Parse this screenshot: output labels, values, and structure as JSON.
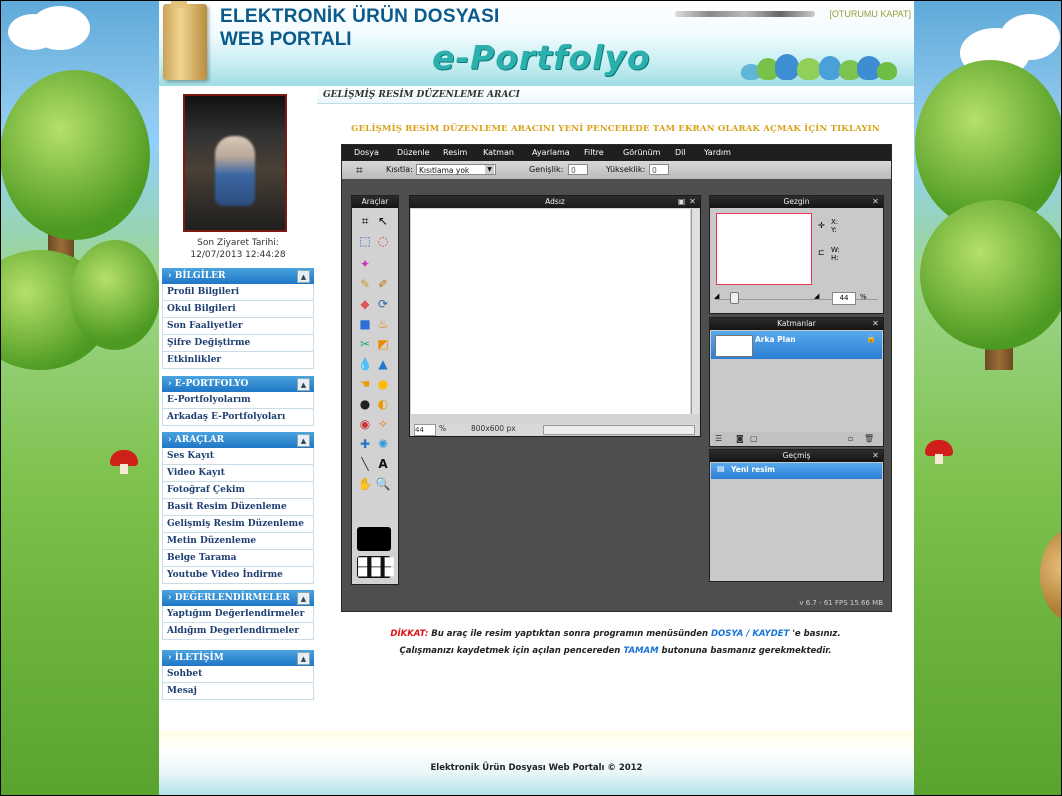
{
  "header": {
    "title_line1": "ELEKTRONİK ÜRÜN DOSYASI",
    "title_line2": "WEB PORTALI",
    "brand": "e-Portfolyo",
    "logout": "[OTURUMU KAPAT]"
  },
  "sidebar": {
    "last_visit_label": "Son Ziyaret Tarihi:",
    "last_visit_value": "12/07/2013 12:44:28",
    "sections": [
      {
        "title": "› BİLGİLER",
        "items": [
          "Profil Bilgileri",
          "Okul Bilgileri",
          "Son Faaliyetler",
          "Şifre Değiştirme",
          "Etkinlikler"
        ]
      },
      {
        "title": "› E-PORTFOLYO",
        "items": [
          "E-Portfolyolarım",
          "Arkadaş E-Portfolyoları"
        ]
      },
      {
        "title": "› ARAÇLAR",
        "items": [
          "Ses Kayıt",
          "Video Kayıt",
          "Fotoğraf Çekim",
          "Basit Resim Düzenleme",
          "Gelişmiş Resim Düzenleme",
          "Metin Düzenleme",
          "Belge Tarama",
          "Youtube Video İndirme"
        ]
      },
      {
        "title": "› DEĞERLENDİRMELER",
        "items": [
          "Yaptığım Değerlendirmeler",
          "Aldığım Degerlendirmeler"
        ]
      },
      {
        "title": "› İLETİŞİM",
        "items": [
          "Sohbet",
          "Mesaj"
        ]
      }
    ]
  },
  "content": {
    "page_title": "GELİŞMİŞ RESİM DÜZENLEME ARACI",
    "open_fullscreen_link": "GELİŞMİŞ RESİM DÜZENLEME ARACINI YENİ PENCEREDE TAM EKRAN OLARAK AÇMAK İÇİN TIKLAYIN"
  },
  "editor": {
    "menu": [
      "Dosya",
      "Düzenle",
      "Resim",
      "Katman",
      "Ayarlama",
      "Filtre",
      "Görünüm",
      "Dil",
      "Yardım"
    ],
    "toolbar": {
      "constraint_label": "Kısıtla:",
      "constraint_value": "Kısıtlama yok",
      "width_label": "Genişlik:",
      "width_value": "0",
      "height_label": "Yükseklik:",
      "height_value": "0"
    },
    "tools_panel_title": "Araçlar",
    "canvas": {
      "title": "Adsız",
      "zoom_value": "44",
      "zoom_unit": "%",
      "size": "800x600 px"
    },
    "navigator": {
      "title": "Gezgin",
      "x_label": "X:",
      "y_label": "Y:",
      "w_label": "W:",
      "h_label": "H:",
      "zoom_value": "44",
      "zoom_unit": "%"
    },
    "layers": {
      "title": "Katmanlar",
      "items": [
        "Arka Plan"
      ]
    },
    "history": {
      "title": "Geçmiş",
      "items": [
        "Yeni resim"
      ]
    },
    "status": "v 6.7 - 61 FPS 15.66 MB"
  },
  "warning": {
    "prefix": "DİKKAT:",
    "line1_a": " Bu araç ile resim yaptıktan sonra programın menüsünden ",
    "line1_highlight": "DOSYA / KAYDET",
    "line1_b": " 'e basınız.",
    "line2_a": "Çalışmanızı kaydetmek için açılan pencereden ",
    "line2_highlight": "TAMAM",
    "line2_b": " butonuna basmanız gerekmektedir."
  },
  "footer": {
    "text": "Elektronik Ürün Dosyası Web Portalı © 2012"
  }
}
